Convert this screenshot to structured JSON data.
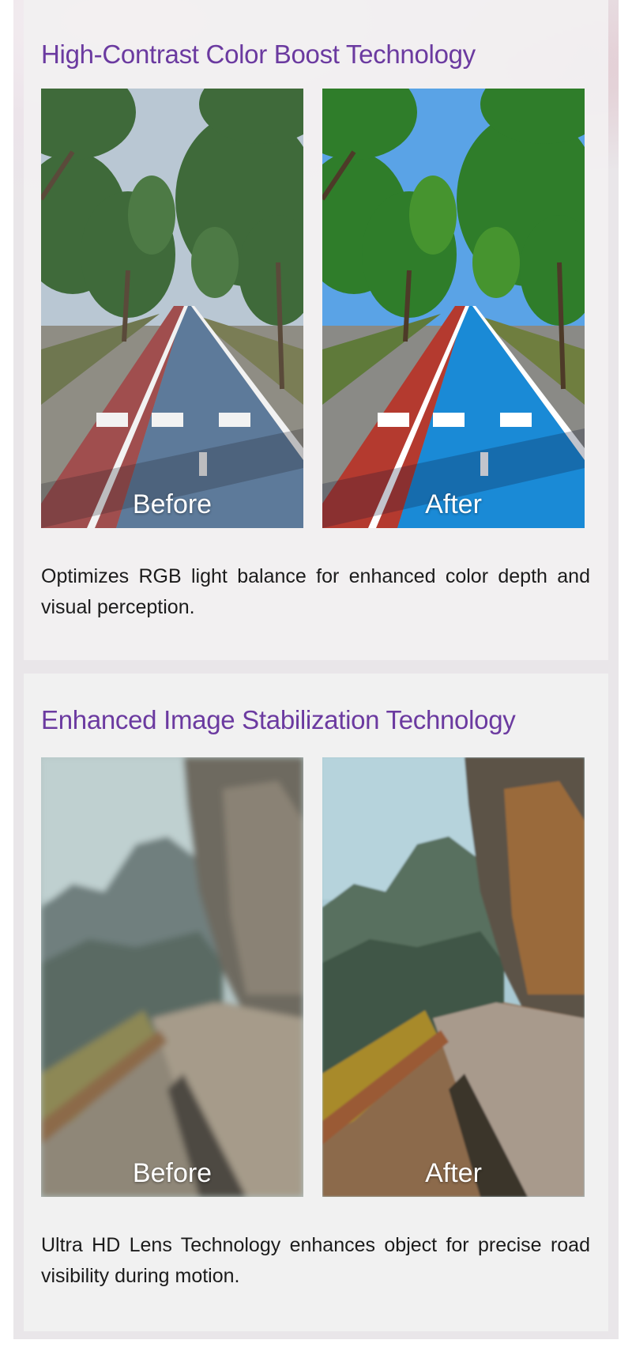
{
  "sections": [
    {
      "title": "High-Contrast Color Boost Technology",
      "before_label": "Before",
      "after_label": "After",
      "before_image": "tree-lined bike lane, muted colors",
      "after_image": "tree-lined bike lane, vivid colors",
      "description": "Optimizes RGB light balance for enhanced color depth and visual perception."
    },
    {
      "title": "Enhanced Image Stabilization Technology",
      "before_label": "Before",
      "after_label": "After",
      "before_image": "mountain cliff road, motion blurred",
      "after_image": "mountain cliff road, sharp",
      "description": "Ultra HD Lens Technology enhances object for precise road visibility during motion."
    }
  ],
  "colors": {
    "title": "#6b3aa0",
    "text": "#1b1b1b",
    "panel": "#f1f1f1",
    "page": "#e9e6e9"
  }
}
